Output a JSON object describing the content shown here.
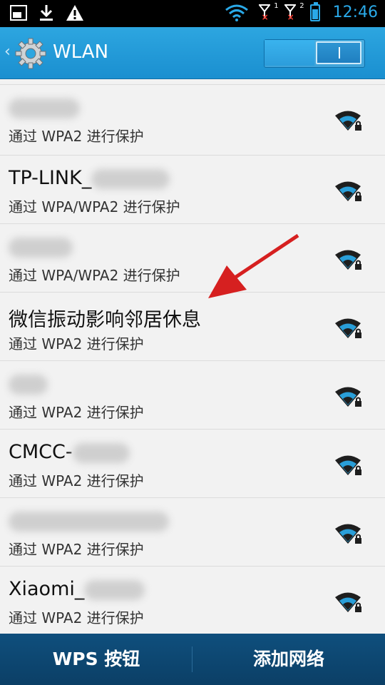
{
  "status_bar": {
    "time": "12:46",
    "icons": [
      "screen-icon",
      "download-icon",
      "warning-icon",
      "wifi-icon",
      "signal-sim1-icon",
      "signal-sim2-icon",
      "battery-icon"
    ],
    "sim1_label": "1",
    "sim2_label": "2"
  },
  "action_bar": {
    "title": "WLAN",
    "switch_state": "on"
  },
  "networks": [
    {
      "name": "",
      "security": "通过 WPA2 进行保护"
    },
    {
      "name": "TP-LINK_",
      "security": "通过 WPA/WPA2 进行保护"
    },
    {
      "name": "",
      "security": "通过 WPA/WPA2 进行保护"
    },
    {
      "name": "微信振动影响邻居休息",
      "security": "通过 WPA2 进行保护"
    },
    {
      "name": "",
      "security": "通过 WPA2 进行保护"
    },
    {
      "name": "CMCC-",
      "security": "通过 WPA2 进行保护"
    },
    {
      "name": "",
      "security": "通过 WPA2 进行保护"
    },
    {
      "name": "Xiaomi_",
      "security": "通过 WPA2 进行保护"
    }
  ],
  "bottom_bar": {
    "wps_label": "WPS 按钮",
    "add_network_label": "添加网络"
  },
  "colors": {
    "accent": "#2aa9e8",
    "action_bar": "#1f95d6",
    "bottom_bar": "#0d4670",
    "annotation": "#d62020"
  }
}
